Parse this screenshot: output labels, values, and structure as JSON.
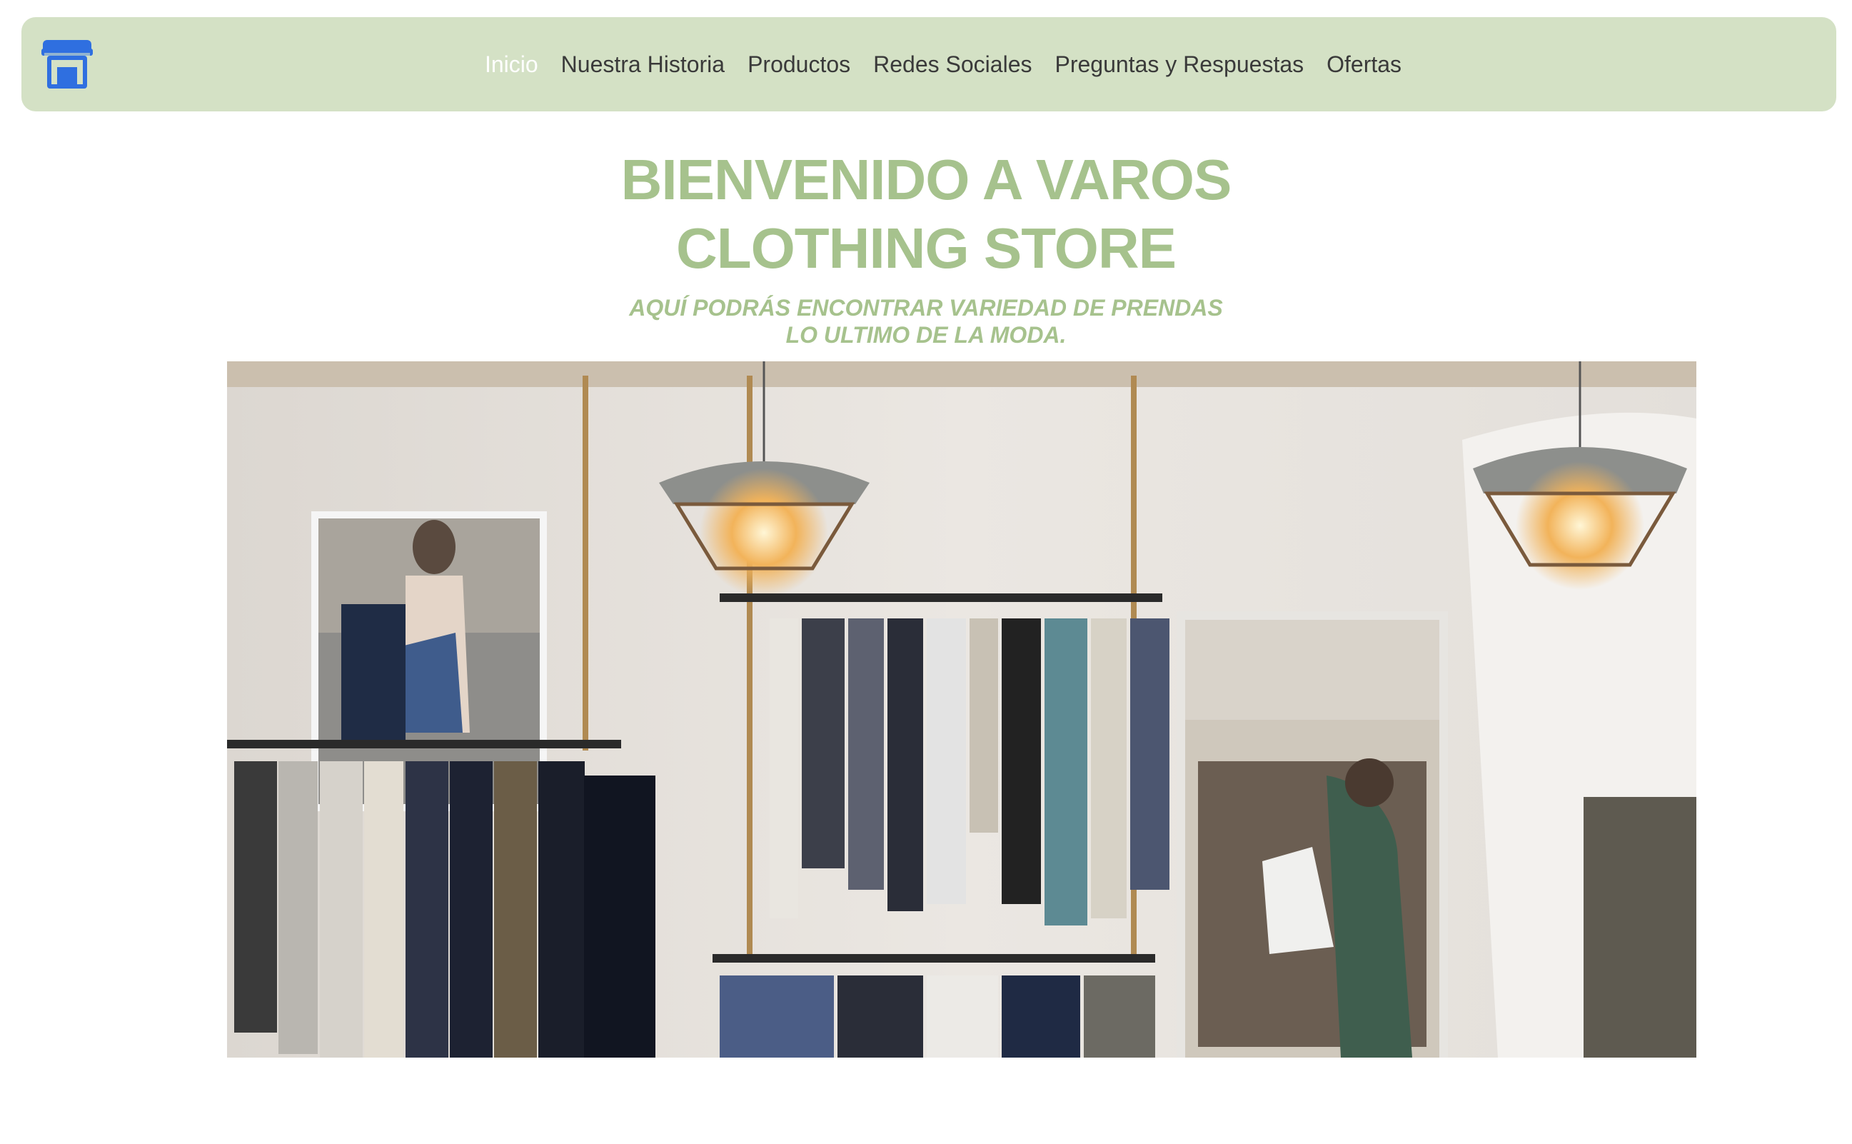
{
  "nav": {
    "brand_icon": "storefront-icon",
    "items": [
      {
        "label": "Inicio",
        "active": true
      },
      {
        "label": "Nuestra Historia",
        "active": false
      },
      {
        "label": "Productos",
        "active": false
      },
      {
        "label": "Redes Sociales",
        "active": false
      },
      {
        "label": "Preguntas y Respuestas",
        "active": false
      },
      {
        "label": "Ofertas",
        "active": false
      }
    ]
  },
  "hero": {
    "title_line1": "BIENVENIDO A VAROS",
    "title_line2": "CLOTHING STORE",
    "subtitle_line1": "AQUÍ PODRÁS ENCONTRAR VARIEDAD DE PRENDAS",
    "subtitle_line2": "LO ULTIMO DE LA MODA.",
    "image": "clothing-store-interior-photo"
  },
  "colors": {
    "navbar_bg": "#d4e1c5",
    "accent_green": "#a6c28d",
    "brand_blue": "#2f6fe0",
    "nav_text": "#3a3a3a",
    "nav_active": "#ffffff"
  }
}
